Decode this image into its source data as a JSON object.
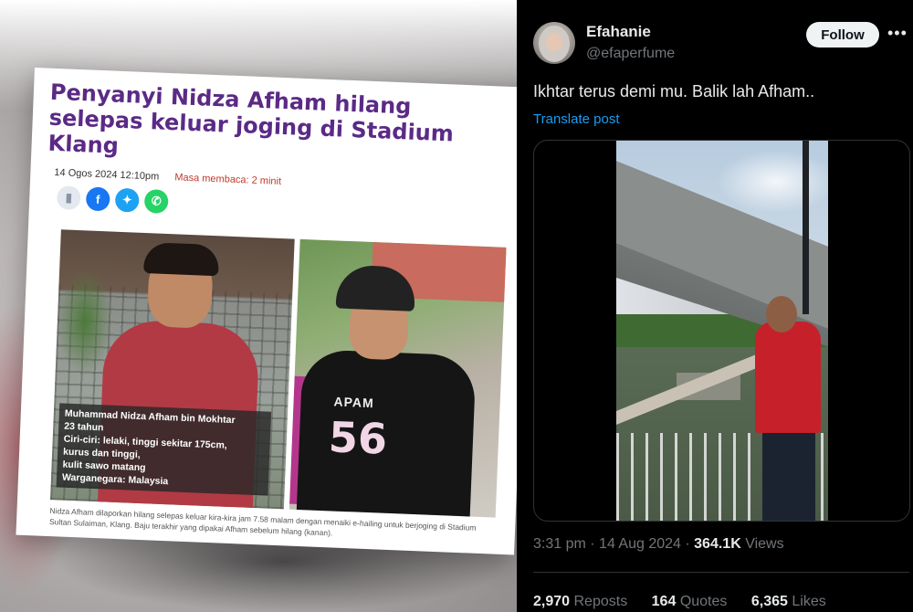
{
  "news": {
    "title": "Penyanyi Nidza Afham hilang selepas keluar joging di Stadium Klang",
    "date": "14 Ogos 2024 12:10pm",
    "reading_time": "Masa membaca: 2 minit",
    "share_icons": [
      "bookmark-icon",
      "facebook-icon",
      "twitter-icon",
      "whatsapp-icon"
    ],
    "caption_lines": [
      "Muhammad Nidza Afham bin Mokhtar",
      "23 tahun",
      "Ciri-ciri: lelaki, tinggi sekitar 175cm,",
      "kurus dan tinggi,",
      "kulit sawo matang",
      "Warganegara: Malaysia"
    ],
    "jersey_name": "APAM",
    "jersey_number": "56",
    "description": "Nidza Afham dilaporkan hilang selepas keluar kira-kira jam 7.58 malam dengan menaiki e-hailing untuk berjoging di Stadium Sultan Sulaiman, Klang. Baju terakhir yang dipakai Afham sebelum hilang (kanan).",
    "title_color": "#5b2a86"
  },
  "tweet": {
    "display_name": "Efahanie",
    "handle": "@efaperfume",
    "follow_label": "Follow",
    "more_icon": "more-dots-icon",
    "text": "Ikhtar terus demi mu. Balik lah Afham..",
    "translate_label": "Translate post",
    "time": "3:31 pm",
    "date": "14 Aug 2024",
    "views_count": "364.1K",
    "views_label": "Views",
    "reposts_count": "2,970",
    "reposts_label": "Reposts",
    "quotes_count": "164",
    "quotes_label": "Quotes",
    "likes_count": "6,365",
    "likes_label": "Likes",
    "accent_color": "#1d9bf0",
    "background_color": "#000000"
  }
}
